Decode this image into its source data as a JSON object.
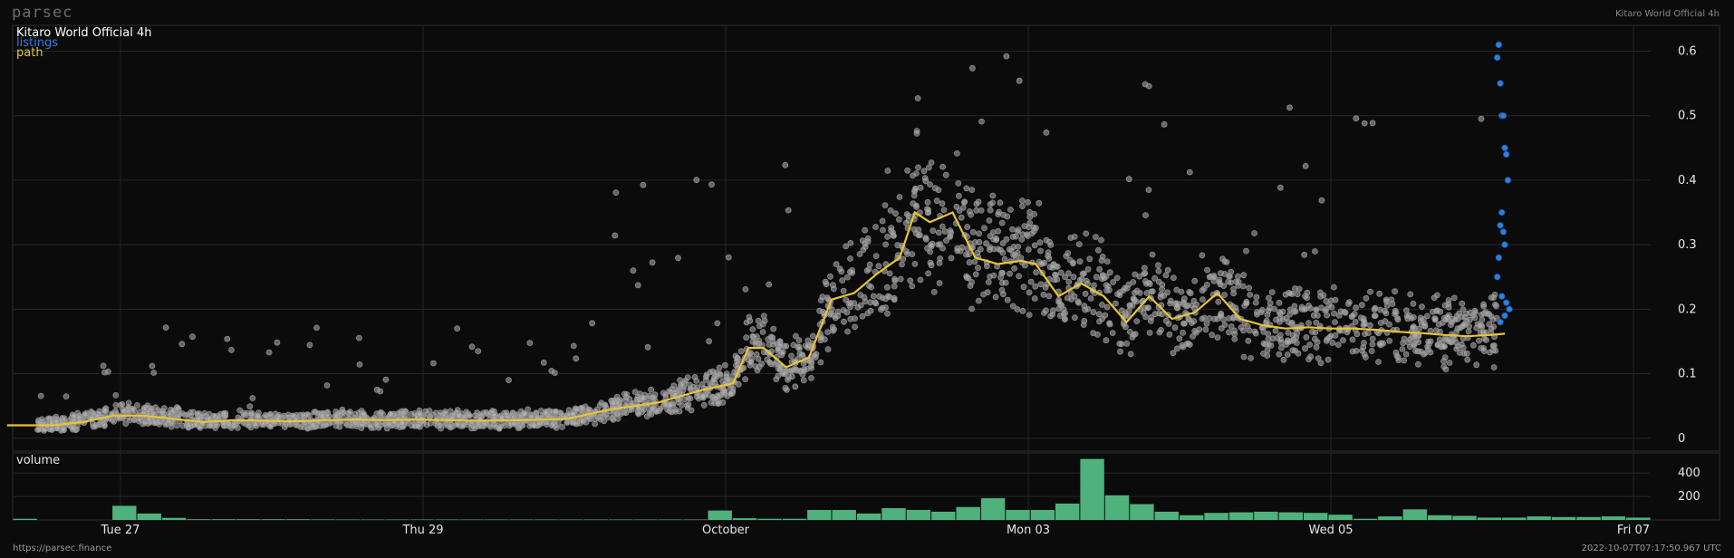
{
  "header": {
    "brand": "parsec",
    "title_right": "Kitaro World Official 4h"
  },
  "legend": {
    "title": "Kitaro World Official 4h",
    "listings": "listings",
    "path": "path"
  },
  "volume_label": "volume",
  "footer": {
    "url": "https://parsec.finance",
    "timestamp": "2022-10-07T07:17:50.967 UTC"
  },
  "colors": {
    "background": "#0b0b0b",
    "grid": "#262626",
    "scatter": "#b4b4b4",
    "listings": "#2f7fe0",
    "path": "#e9c433",
    "volume": "#4fb27c"
  },
  "chart_data": [
    {
      "type": "scatter",
      "title": "Kitaro World Official 4h",
      "x_tick_labels": [
        "Tue 27",
        "Thu 29",
        "October",
        "Mon 03",
        "Wed 05",
        "Fri 07"
      ],
      "y_ticks": [
        0,
        0.1,
        0.2,
        0.3,
        0.4,
        0.5,
        0.6
      ],
      "ylim": [
        -0.02,
        0.64
      ],
      "xlim_days": [
        0,
        10.04
      ],
      "series": [
        {
          "name": "path",
          "type": "line",
          "x": [
            0,
            0.3,
            0.5,
            0.7,
            0.9,
            1.1,
            1.3,
            1.5,
            1.7,
            1.9,
            2.1,
            2.3,
            2.5,
            2.7,
            2.9,
            3.1,
            3.4,
            3.7,
            4.0,
            4.3,
            4.6,
            4.8,
            4.9,
            5.0,
            5.15,
            5.3,
            5.45,
            5.6,
            5.75,
            5.9,
            6.0,
            6.1,
            6.25,
            6.4,
            6.55,
            6.7,
            6.8,
            6.95,
            7.1,
            7.25,
            7.4,
            7.55,
            7.7,
            7.85,
            8.0,
            8.15,
            8.3,
            8.45,
            8.6,
            8.75,
            8.9,
            9.05,
            9.2,
            9.35,
            9.5,
            9.65,
            9.8,
            9.9
          ],
          "y": [
            0.02,
            0.02,
            0.025,
            0.035,
            0.035,
            0.03,
            0.025,
            0.028,
            0.027,
            0.026,
            0.028,
            0.029,
            0.028,
            0.029,
            0.028,
            0.027,
            0.028,
            0.03,
            0.045,
            0.055,
            0.075,
            0.085,
            0.14,
            0.14,
            0.11,
            0.125,
            0.215,
            0.225,
            0.255,
            0.28,
            0.35,
            0.335,
            0.35,
            0.28,
            0.27,
            0.275,
            0.27,
            0.22,
            0.24,
            0.22,
            0.18,
            0.22,
            0.185,
            0.195,
            0.225,
            0.185,
            0.175,
            0.17,
            0.172,
            0.17,
            0.17,
            0.168,
            0.165,
            0.163,
            0.16,
            0.158,
            0.16,
            0.162
          ]
        },
        {
          "name": "listings",
          "type": "scatter",
          "x": [
            9.85,
            9.86,
            9.87,
            9.88,
            9.89,
            9.9,
            9.91,
            9.92,
            9.88,
            9.87,
            9.89,
            9.9,
            9.86,
            9.85,
            9.88,
            9.91,
            9.93,
            9.9,
            9.87
          ],
          "y": [
            0.59,
            0.61,
            0.55,
            0.5,
            0.5,
            0.45,
            0.44,
            0.4,
            0.35,
            0.33,
            0.32,
            0.3,
            0.28,
            0.25,
            0.22,
            0.21,
            0.2,
            0.19,
            0.18
          ]
        }
      ]
    },
    {
      "type": "bar",
      "title": "volume",
      "y_ticks": [
        200,
        400
      ],
      "ylim": [
        0,
        540
      ],
      "values": [
        10,
        0,
        0,
        0,
        120,
        55,
        18,
        6,
        6,
        6,
        6,
        6,
        5,
        4,
        4,
        4,
        4,
        4,
        4,
        4,
        4,
        4,
        4,
        4,
        4,
        4,
        4,
        4,
        80,
        15,
        10,
        10,
        85,
        85,
        55,
        100,
        85,
        70,
        110,
        185,
        85,
        85,
        140,
        520,
        210,
        135,
        70,
        40,
        60,
        65,
        70,
        65,
        60,
        45,
        10,
        30,
        90,
        40,
        35,
        20,
        20,
        30,
        25,
        25,
        30,
        20
      ]
    }
  ]
}
